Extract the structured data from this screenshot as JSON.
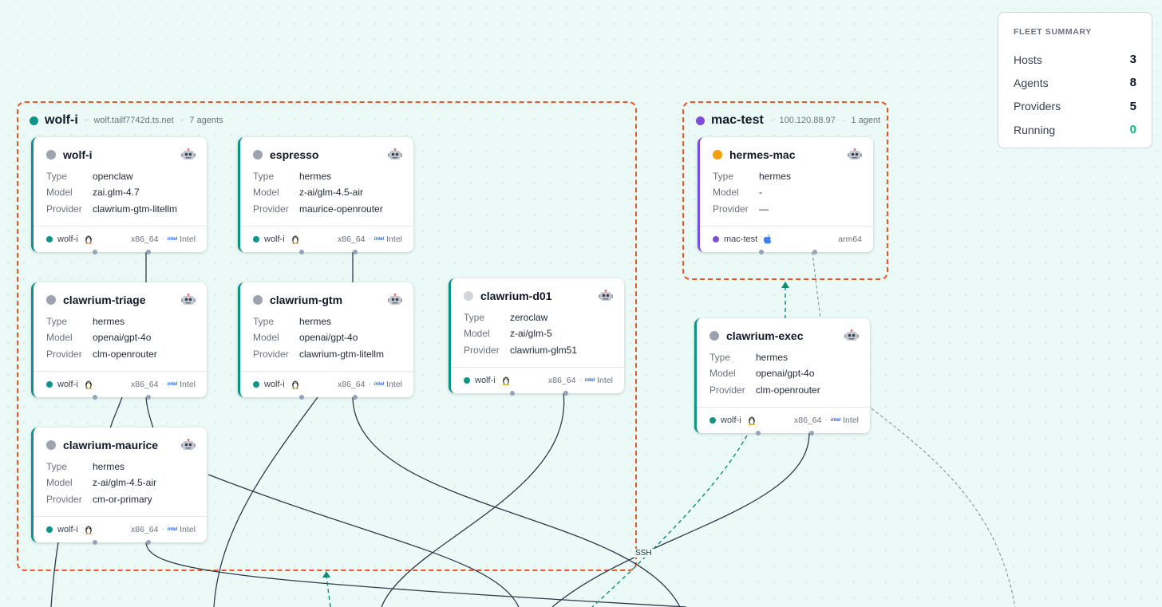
{
  "colors": {
    "accent_teal": "#0d9488",
    "accent_purple": "#7c4dd8",
    "group_border": "#e8572a",
    "status_orange": "#f59e0b",
    "status_gray": "#9ca3af",
    "running_green": "#10b981"
  },
  "summary": {
    "title": "FLEET SUMMARY",
    "rows": [
      {
        "label": "Hosts",
        "value": "3"
      },
      {
        "label": "Agents",
        "value": "8"
      },
      {
        "label": "Providers",
        "value": "5"
      },
      {
        "label": "Running",
        "value": "0"
      }
    ]
  },
  "field_labels": {
    "type": "Type",
    "model": "Model",
    "provider": "Provider"
  },
  "groups": {
    "wolf": {
      "name": "wolf-i",
      "address": "wolf.tailf7742d.ts.net",
      "agents": "7 agents",
      "sep": "·"
    },
    "mac": {
      "name": "mac-test",
      "address": "100.120.88.97",
      "agents": "1 agent",
      "sep": "·"
    }
  },
  "edge_label": "SSH",
  "agents": [
    {
      "name": "wolf-i",
      "type": "openclaw",
      "model": "zai.glm-4.7",
      "provider": "clawrium-gtm-litellm",
      "host": "wolf-i",
      "arch": "x86_64",
      "cpu": "Intel",
      "cpu_chip": "intel",
      "sep": "·",
      "os_icon": "linux-tux-icon"
    },
    {
      "name": "espresso",
      "type": "hermes",
      "model": "z-ai/glm-4.5-air",
      "provider": "maurice-openrouter",
      "host": "wolf-i",
      "arch": "x86_64",
      "cpu": "Intel",
      "cpu_chip": "intel",
      "sep": "·",
      "os_icon": "linux-tux-icon"
    },
    {
      "name": "clawrium-triage",
      "type": "hermes",
      "model": "openai/gpt-4o",
      "provider": "clm-openrouter",
      "host": "wolf-i",
      "arch": "x86_64",
      "cpu": "Intel",
      "cpu_chip": "intel",
      "sep": "·",
      "os_icon": "linux-tux-icon"
    },
    {
      "name": "clawrium-gtm",
      "type": "hermes",
      "model": "openai/gpt-4o",
      "provider": "clawrium-gtm-litellm",
      "host": "wolf-i",
      "arch": "x86_64",
      "cpu": "Intel",
      "cpu_chip": "intel",
      "sep": "·",
      "os_icon": "linux-tux-icon"
    },
    {
      "name": "clawrium-d01",
      "type": "zeroclaw",
      "model": "z-ai/glm-5",
      "provider": "clawrium-glm51",
      "host": "wolf-i",
      "arch": "x86_64",
      "cpu": "Intel",
      "cpu_chip": "intel",
      "sep": "·",
      "os_icon": "linux-tux-icon"
    },
    {
      "name": "clawrium-maurice",
      "type": "hermes",
      "model": "z-ai/glm-4.5-air",
      "provider": "cm-or-primary",
      "host": "wolf-i",
      "arch": "x86_64",
      "cpu": "Intel",
      "cpu_chip": "intel",
      "sep": "·",
      "os_icon": "linux-tux-icon"
    },
    {
      "name": "hermes-mac",
      "type": "hermes",
      "model": "-",
      "provider": "—",
      "host": "mac-test",
      "arch": "arm64",
      "os_icon": "apple-icon"
    },
    {
      "name": "clawrium-exec",
      "type": "hermes",
      "model": "openai/gpt-4o",
      "provider": "clm-openrouter",
      "host": "wolf-i",
      "arch": "x86_64",
      "cpu": "Intel",
      "cpu_chip": "intel",
      "sep": "·",
      "os_icon": "linux-tux-icon"
    }
  ]
}
